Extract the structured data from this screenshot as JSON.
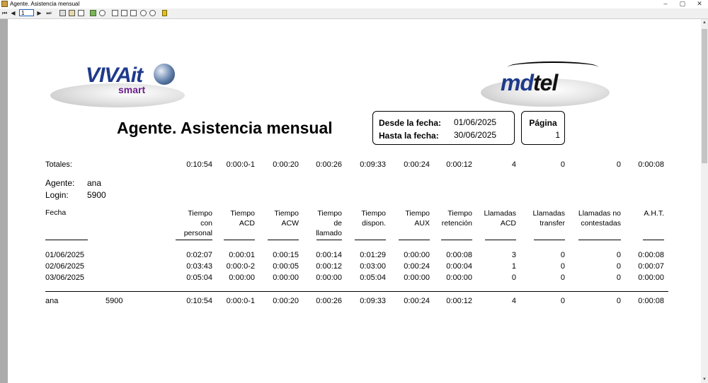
{
  "window": {
    "title": "Agente. Asistencia mensual",
    "controls": [
      "–",
      "▢",
      "✕"
    ]
  },
  "toolbar": {
    "first": "⏮",
    "prev": "◀",
    "page_value": "1",
    "next": "▶",
    "last": "⏭"
  },
  "logos": {
    "left": {
      "main": "VIVAit",
      "sub": "smart"
    },
    "right": {
      "pre": "md",
      "post": "tel"
    }
  },
  "report": {
    "title": "Agente. Asistencia mensual",
    "desde_label": "Desde la fecha:",
    "desde_value": "01/06/2025",
    "hasta_label": "Hasta la fecha:",
    "hasta_value": "30/06/2025",
    "pagina_label": "Página",
    "pagina_value": "1",
    "totales_label": "Totales:",
    "totales": [
      "0:10:54",
      "0:00:0-1",
      "0:00:20",
      "0:00:26",
      "0:09:33",
      "0:00:24",
      "0:00:12",
      "4",
      "0",
      "0",
      "0:00:08"
    ],
    "agente_label": "Agente:",
    "agente_value": "ana",
    "login_label": "Login:",
    "login_value": "5900",
    "fecha_header": "Fecha",
    "headers": [
      [
        "Tiempo",
        "con",
        "personal"
      ],
      [
        "Tiempo",
        "ACD"
      ],
      [
        "Tiempo",
        "ACW"
      ],
      [
        "Tiempo",
        "de",
        "llamado"
      ],
      [
        "Tiempo",
        "dispon."
      ],
      [
        "Tiempo",
        "AUX"
      ],
      [
        "Tiempo",
        "retención"
      ],
      [
        "Llamadas",
        "ACD"
      ],
      [
        "Llamadas",
        "transfer"
      ],
      [
        "Llamadas no",
        "contestadas"
      ],
      [
        "A.H.T."
      ]
    ],
    "rows": [
      {
        "fecha": "01/06/2025",
        "values": [
          "0:02:07",
          "0:00:01",
          "0:00:15",
          "0:00:14",
          "0:01:29",
          "0:00:00",
          "0:00:08",
          "3",
          "0",
          "0",
          "0:00:08"
        ]
      },
      {
        "fecha": "02/06/2025",
        "values": [
          "0:03:43",
          "0:00:0-2",
          "0:00:05",
          "0:00:12",
          "0:03:00",
          "0:00:24",
          "0:00:04",
          "1",
          "0",
          "0",
          "0:00:07"
        ]
      },
      {
        "fecha": "03/06/2025",
        "values": [
          "0:05:04",
          "0:00:00",
          "0:00:00",
          "0:00:00",
          "0:05:04",
          "0:00:00",
          "0:00:00",
          "0",
          "0",
          "0",
          "0:00:00"
        ]
      }
    ],
    "summary": {
      "agent": "ana",
      "login": "5900",
      "values": [
        "0:10:54",
        "0:00:0-1",
        "0:00:20",
        "0:00:26",
        "0:09:33",
        "0:00:24",
        "0:00:12",
        "4",
        "0",
        "0",
        "0:00:08"
      ]
    }
  }
}
